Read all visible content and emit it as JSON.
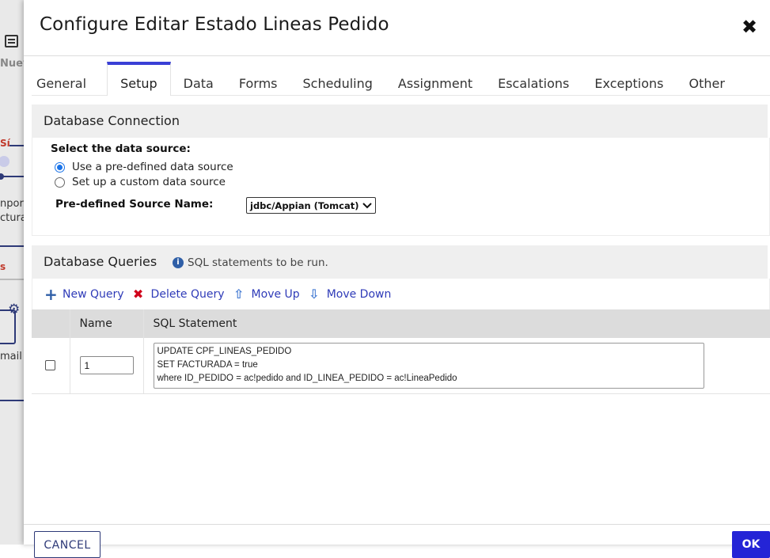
{
  "background_app": {
    "texts": [
      "Nuev",
      "Sí",
      "npor",
      "ctura",
      "s",
      "mail"
    ]
  },
  "modal": {
    "title": "Configure Editar Estado Lineas Pedido",
    "close_symbol": "✖"
  },
  "tabs": [
    {
      "label": "General",
      "active": false
    },
    {
      "label": "Setup",
      "active": true
    },
    {
      "label": "Data",
      "active": false
    },
    {
      "label": "Forms",
      "active": false
    },
    {
      "label": "Scheduling",
      "active": false
    },
    {
      "label": "Assignment",
      "active": false
    },
    {
      "label": "Escalations",
      "active": false
    },
    {
      "label": "Exceptions",
      "active": false
    },
    {
      "label": "Other",
      "active": false
    }
  ],
  "db_connection": {
    "header": "Database Connection",
    "select_label": "Select the data source:",
    "option_predefined": "Use a pre-defined data source",
    "option_custom": "Set up a custom data source",
    "source_name_label": "Pre-defined Source Name:",
    "source_name_value": "jdbc/Appian (Tomcat)"
  },
  "db_queries": {
    "header": "Database Queries",
    "info_text": "SQL statements to be run.",
    "toolbar": {
      "new_query": "New Query",
      "delete_query": "Delete Query",
      "move_up": "Move Up",
      "move_down": "Move Down"
    },
    "columns": {
      "name": "Name",
      "sql": "SQL Statement"
    },
    "rows": [
      {
        "name": "1",
        "sql": "UPDATE CPF_LINEAS_PEDIDO\nSET FACTURADA = true\nwhere ID_PEDIDO = ac!pedido and ID_LINEA_PEDIDO = ac!LineaPedido"
      }
    ]
  },
  "footer": {
    "cancel_label": "CANCEL",
    "ok_label": "OK"
  },
  "colors": {
    "accent": "#3a3fd6",
    "link": "#2f3bb8",
    "delete": "#d0021b",
    "primary_button": "#2424d6"
  }
}
